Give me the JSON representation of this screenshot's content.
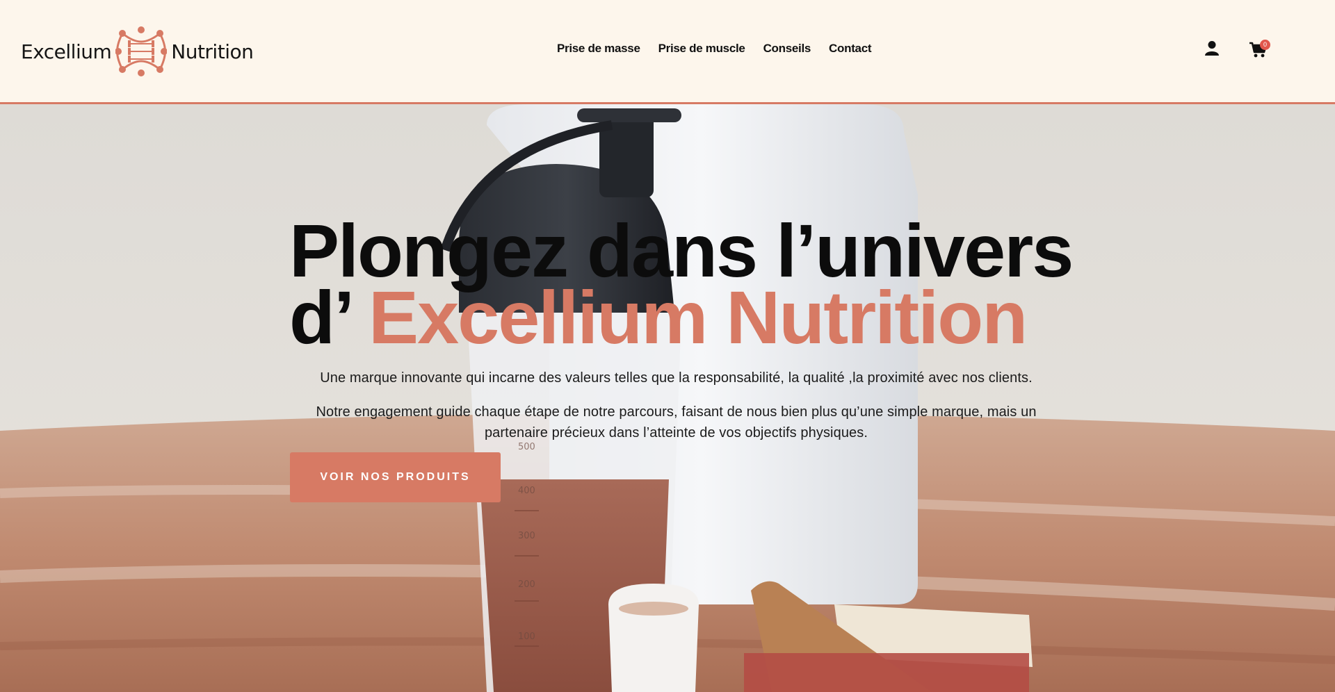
{
  "brand": {
    "name_left": "Excellium",
    "name_right": "Nutrition",
    "accent_color": "#d77a64",
    "background_color": "#fdf6ec"
  },
  "nav": {
    "items": [
      {
        "label": "Prise de masse"
      },
      {
        "label": "Prise de muscle"
      },
      {
        "label": "Conseils"
      },
      {
        "label": "Contact"
      }
    ]
  },
  "header_actions": {
    "account_icon": "user-icon",
    "cart_icon": "shopping-cart-icon",
    "cart_count": "0"
  },
  "hero": {
    "headline_line1": "Plongez dans l’univers",
    "headline_prefix": "d’",
    "headline_accent": "Excellium Nutrition",
    "paragraph1": "Une marque innovante qui incarne des valeurs telles que la responsabilité, la qualité ,la proximité avec nos clients.",
    "paragraph2": "Notre engagement guide chaque étape de notre parcours, faisant de nous bien plus qu’une simple marque, mais un partenaire précieux dans l’atteinte de vos objectifs physiques.",
    "cta_label": "VOIR NOS PRODUITS",
    "shaker_marks": [
      "500",
      "400",
      "300",
      "200",
      "100"
    ]
  }
}
